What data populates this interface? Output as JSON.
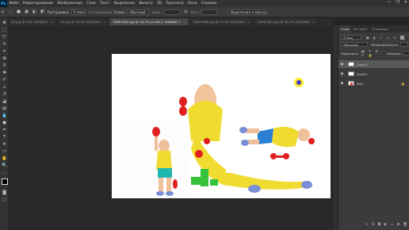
{
  "menubar": {
    "logo": "Ps",
    "items": [
      "Файл",
      "Редактирование",
      "Изображение",
      "Слои",
      "Текст",
      "Выделение",
      "Фильтр",
      "3D",
      "Просмотр",
      "Окно",
      "Справка"
    ],
    "window_controls": [
      "—",
      "❐",
      "✕"
    ]
  },
  "optbar": {
    "feather_label": "Растушевка:",
    "feather_value": "0 пикс.",
    "antialias": "Сглаживание",
    "style_label": "Стиль:",
    "style_value": "Обычный",
    "width_label": "Шир.:",
    "height_label": "Выс.:",
    "select_mask_button": "Выделение и маска..."
  },
  "tabs": [
    {
      "label": "02.jpg @ 25% (RGB/8#)",
      "active": false
    },
    {
      "label": "01.jpg @ 16,7% (RGB/8#)",
      "active": false
    },
    {
      "label": "TDRA7061.jpg @ 16,7% (Слой 2, RGB/8#) *",
      "active": true
    },
    {
      "label": "TDRA7066.jpg @ 22,6% (RGB/8#)",
      "active": false
    },
    {
      "label": "TDRA7063.jpg @ 16,7% (RGB/8#)",
      "active": false
    }
  ],
  "tools": [
    "move-icon",
    "marquee-icon",
    "lasso-icon",
    "quick-select-icon",
    "crop-icon",
    "frame-icon",
    "eyedropper-icon",
    "healing-icon",
    "brush-icon",
    "stamp-icon",
    "history-brush-icon",
    "eraser-icon",
    "gradient-icon",
    "blur-icon",
    "dodge-icon",
    "pen-icon",
    "type-icon",
    "path-select-icon",
    "rectangle-icon",
    "hand-icon",
    "zoom-icon",
    "more-icon",
    "color-swatches-icon",
    "quick-mask-icon",
    "screen-mode-icon"
  ],
  "panel": {
    "tabs": [
      "Слои",
      "История",
      "Операции"
    ],
    "search_value": "Вид",
    "blend_mode": "Обычные",
    "opacity_label": "Непрозрачность:",
    "lock_label": "Закрепить:",
    "fill_label": "Заливка:",
    "layers": [
      {
        "name": "Слой 2",
        "selected": true
      },
      {
        "name": "Слой 1",
        "selected": false
      },
      {
        "name": "Фон",
        "selected": false,
        "locked": true
      }
    ],
    "footer_icons": [
      "link-icon",
      "fx-icon",
      "mask-icon",
      "adjustment-icon",
      "group-icon",
      "new-layer-icon",
      "trash-icon"
    ]
  },
  "colors": {
    "app_bg": "#252525",
    "panel_bg": "#3b3b3b",
    "selected_layer": "#585858",
    "accent": "#31a8ff"
  }
}
